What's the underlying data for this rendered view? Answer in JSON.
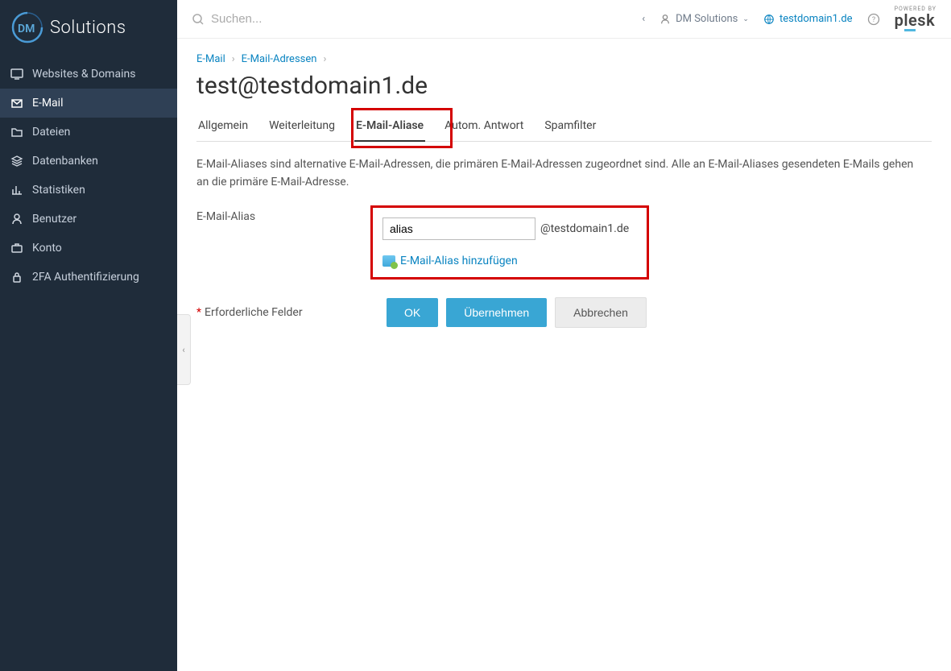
{
  "brand": {
    "name": "Solutions",
    "prefix": "DM",
    "powered_by": "POWERED BY",
    "plesk": "plesk"
  },
  "search": {
    "placeholder": "Suchen..."
  },
  "topbar": {
    "account": "DM Solutions",
    "domain": "testdomain1.de"
  },
  "sidebar": {
    "items": [
      {
        "label": "Websites & Domains"
      },
      {
        "label": "E-Mail"
      },
      {
        "label": "Dateien"
      },
      {
        "label": "Datenbanken"
      },
      {
        "label": "Statistiken"
      },
      {
        "label": "Benutzer"
      },
      {
        "label": "Konto"
      },
      {
        "label": "2FA Authentifizierung"
      }
    ]
  },
  "breadcrumb": {
    "a": "E-Mail",
    "b": "E-Mail-Adressen"
  },
  "page_title": "test@testdomain1.de",
  "tabs": {
    "items": [
      {
        "label": "Allgemein"
      },
      {
        "label": "Weiterleitung"
      },
      {
        "label": "E-Mail-Aliase"
      },
      {
        "label": "Autom. Antwort"
      },
      {
        "label": "Spamfilter"
      }
    ]
  },
  "description": "E-Mail-Aliases sind alternative E-Mail-Adressen, die primären E-Mail-Adressen zugeordnet sind. Alle an E-Mail-Aliases gesendeten E-Mails gehen an die primäre E-Mail-Adresse.",
  "form": {
    "alias_label": "E-Mail-Alias",
    "alias_value": "alias",
    "domain_suffix": "@testdomain1.de",
    "add_link": "E-Mail-Alias hinzufügen",
    "required_note": "Erforderliche Felder"
  },
  "buttons": {
    "ok": "OK",
    "apply": "Übernehmen",
    "cancel": "Abbrechen"
  }
}
